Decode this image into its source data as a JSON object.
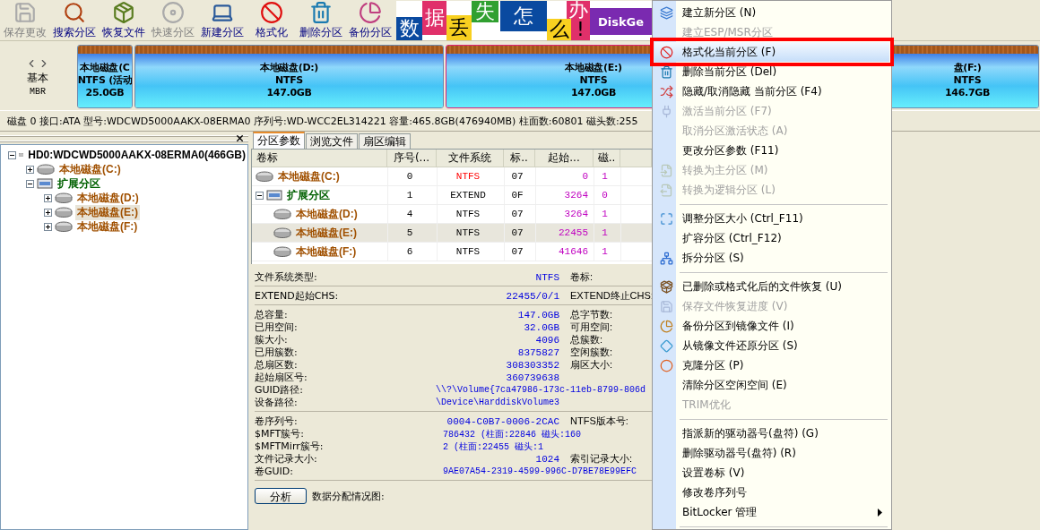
{
  "toolbar": {
    "buttons": [
      {
        "label": "保存更改",
        "disabled": true
      },
      {
        "label": "搜索分区",
        "disabled": false
      },
      {
        "label": "恢复文件",
        "disabled": false
      },
      {
        "label": "快速分区",
        "disabled": true
      },
      {
        "label": "新建分区",
        "disabled": false
      },
      {
        "label": "格式化",
        "disabled": false
      },
      {
        "label": "删除分区",
        "disabled": false
      },
      {
        "label": "备份分区",
        "disabled": false
      }
    ],
    "banner": [
      "数",
      "据",
      "丢",
      "失",
      "怎",
      "么",
      "办",
      "!",
      "DiskGe"
    ]
  },
  "disk_map": {
    "type": "基本",
    "scheme": "MBR",
    "partitions": [
      {
        "name": "本地磁盘(C",
        "fs": "NTFS (活动",
        "size": "25.0GB",
        "selected": false
      },
      {
        "name": "本地磁盘(D:)",
        "fs": "NTFS",
        "size": "147.0GB",
        "selected": false
      },
      {
        "name": "本地磁盘(E:)",
        "fs": "NTFS",
        "size": "147.0GB",
        "selected": true
      },
      {
        "name": "盘(F:)",
        "fs": "NTFS",
        "size": "146.7GB",
        "selected": false
      }
    ]
  },
  "disk_info": "磁盘 0 接口:ATA 型号:WDCWD5000AAKX-08ERMA0 序列号:WD-WCC2EL314221 容量:465.8GB(476940MB) 柱面数:60801 磁头数:255",
  "tree": [
    {
      "label": "HD0:WDCWD5000AAKX-08ERMA0(466GB)",
      "kind": "disk",
      "expanded": true,
      "selected": false,
      "children": [
        {
          "label": "本地磁盘(C:)",
          "kind": "partition",
          "expanded": false,
          "selected": false
        },
        {
          "label": "扩展分区",
          "kind": "extended",
          "expanded": true,
          "selected": false,
          "children": [
            {
              "label": "本地磁盘(D:)",
              "kind": "partition",
              "expanded": false,
              "selected": false
            },
            {
              "label": "本地磁盘(E:)",
              "kind": "partition",
              "expanded": false,
              "selected": true
            },
            {
              "label": "本地磁盘(F:)",
              "kind": "partition",
              "expanded": false,
              "selected": false
            }
          ]
        }
      ]
    }
  ],
  "tabs": [
    {
      "label": "分区参数",
      "selected": true
    },
    {
      "label": "浏览文件",
      "selected": false
    },
    {
      "label": "扇区编辑",
      "selected": false
    }
  ],
  "table": {
    "columns": [
      "卷标",
      "序号(...",
      "文件系统",
      "标..",
      "起始...",
      "磁.."
    ],
    "rows": [
      {
        "label": "本地磁盘(C:)",
        "kind": "partition",
        "number": "0",
        "fs": "NTFS",
        "color": "#ff0000",
        "type": "07",
        "start": "0",
        "head": "1",
        "selected": false
      },
      {
        "label": "扩展分区",
        "kind": "extended",
        "expanded": true,
        "number": "1",
        "fs": "EXTEND",
        "color": "#000000",
        "type": "0F",
        "start": "3264",
        "head": "0",
        "selected": false,
        "children": [
          {
            "label": "本地磁盘(D:)",
            "kind": "partition",
            "number": "4",
            "fs": "NTFS",
            "color": "#000000",
            "type": "07",
            "start": "3264",
            "head": "1",
            "selected": false
          },
          {
            "label": "本地磁盘(E:)",
            "kind": "partition",
            "number": "5",
            "fs": "NTFS",
            "color": "#000000",
            "type": "07",
            "start": "22455",
            "head": "1",
            "selected": true
          },
          {
            "label": "本地磁盘(F:)",
            "kind": "partition",
            "number": "6",
            "fs": "NTFS",
            "color": "#000000",
            "type": "07",
            "start": "41646",
            "head": "1",
            "selected": false
          }
        ]
      }
    ]
  },
  "details": [
    {
      "rows": [
        {
          "kind": "pair",
          "label": "文件系统类型:",
          "value": "NTFS",
          "label2": "卷标:"
        }
      ]
    },
    {
      "rows": [
        {
          "kind": "pair",
          "label": "EXTEND起始CHS:",
          "value": "22455/0/1",
          "label2": "EXTEND终止CHS:"
        }
      ]
    },
    {
      "rows": [
        {
          "kind": "pair",
          "label": "总容量:",
          "value": "147.0GB",
          "label2": "总字节数:"
        },
        {
          "kind": "pair",
          "label": "已用空间:",
          "value": "32.0GB",
          "label2": "可用空间:"
        },
        {
          "kind": "pair",
          "label": "簇大小:",
          "value": "4096",
          "label2": "总簇数:"
        },
        {
          "kind": "pair",
          "label": "已用簇数:",
          "value": "8375827",
          "label2": "空闲簇数:"
        },
        {
          "kind": "pair",
          "label": "总扇区数:",
          "value": "308303352",
          "label2": "扇区大小:"
        },
        {
          "kind": "pair",
          "label": "起始扇区号:",
          "value": "360739638"
        },
        {
          "kind": "path",
          "label": "GUID路径:",
          "value": "\\\\?\\Volume{7ca47986-173c-11eb-8799-806d"
        },
        {
          "kind": "path",
          "label": "设备路径:",
          "value": "\\Device\\HarddiskVolume3"
        }
      ]
    },
    {
      "rows": [
        {
          "kind": "pair",
          "label": "卷序列号:",
          "value": "0004-C0B7-0006-2CAC",
          "label2": "NTFS版本号:"
        },
        {
          "kind": "long",
          "label": "$MFT簇号:",
          "value": "786432 (柱面:22846 磁头:160"
        },
        {
          "kind": "long",
          "label": "$MFTMirr簇号:",
          "value": "2 (柱面:22455 磁头:1"
        },
        {
          "kind": "pair",
          "label": "文件记录大小:",
          "value": "1024",
          "label2": "索引记录大小:"
        },
        {
          "kind": "long",
          "label": "卷GUID:",
          "value": "9AE07A54-2319-4599-996C-D7BE78E99EFC"
        }
      ]
    }
  ],
  "analyze": {
    "button": "分析",
    "caption": "数据分配情况图:"
  },
  "context_menu": [
    {
      "kind": "item",
      "label": "建立新分区 (N)",
      "disabled": false,
      "selected": false
    },
    {
      "kind": "item",
      "label": "建立ESP/MSR分区",
      "disabled": true,
      "selected": false
    },
    {
      "kind": "item",
      "label": "格式化当前分区 (F)",
      "disabled": false,
      "selected": true
    },
    {
      "kind": "item",
      "label": "删除当前分区 (Del)",
      "disabled": false,
      "selected": false
    },
    {
      "kind": "item",
      "label": "隐藏/取消隐藏 当前分区 (F4)",
      "disabled": false,
      "selected": false
    },
    {
      "kind": "item",
      "label": "激活当前分区 (F7)",
      "disabled": true,
      "selected": false
    },
    {
      "kind": "item",
      "label": "取消分区激活状态 (A)",
      "disabled": true,
      "selected": false
    },
    {
      "kind": "item",
      "label": "更改分区参数 (F11)",
      "disabled": false,
      "selected": false
    },
    {
      "kind": "item",
      "label": "转换为主分区 (M)",
      "disabled": true,
      "selected": false
    },
    {
      "kind": "item",
      "label": "转换为逻辑分区 (L)",
      "disabled": true,
      "selected": false
    },
    {
      "kind": "separator"
    },
    {
      "kind": "item",
      "label": "调整分区大小 (Ctrl_F11)",
      "disabled": false,
      "selected": false
    },
    {
      "kind": "item",
      "label": "扩容分区 (Ctrl_F12)",
      "disabled": false,
      "selected": false
    },
    {
      "kind": "item",
      "label": "拆分分区 (S)",
      "disabled": false,
      "selected": false
    },
    {
      "kind": "separator"
    },
    {
      "kind": "item",
      "label": "已删除或格式化后的文件恢复 (U)",
      "disabled": false,
      "selected": false
    },
    {
      "kind": "item",
      "label": "保存文件恢复进度 (V)",
      "disabled": true,
      "selected": false
    },
    {
      "kind": "item",
      "label": "备份分区到镜像文件 (I)",
      "disabled": false,
      "selected": false
    },
    {
      "kind": "item",
      "label": "从镜像文件还原分区 (S)",
      "disabled": false,
      "selected": false
    },
    {
      "kind": "item",
      "label": "克隆分区 (P)",
      "disabled": false,
      "selected": false
    },
    {
      "kind": "item",
      "label": "清除分区空闲空间 (E)",
      "disabled": false,
      "selected": false
    },
    {
      "kind": "item",
      "label": "TRIM优化",
      "disabled": true,
      "selected": false
    },
    {
      "kind": "separator"
    },
    {
      "kind": "item",
      "label": "指派新的驱动器号(盘符) (G)",
      "disabled": false,
      "selected": false
    },
    {
      "kind": "item",
      "label": "删除驱动器号(盘符) (R)",
      "disabled": false,
      "selected": false
    },
    {
      "kind": "item",
      "label": "设置卷标 (V)",
      "disabled": false,
      "selected": false
    },
    {
      "kind": "item",
      "label": "修改卷序列号",
      "disabled": false,
      "selected": false
    },
    {
      "kind": "submenu",
      "label": "BitLocker 管理",
      "disabled": false,
      "selected": false
    },
    {
      "kind": "separator"
    }
  ]
}
